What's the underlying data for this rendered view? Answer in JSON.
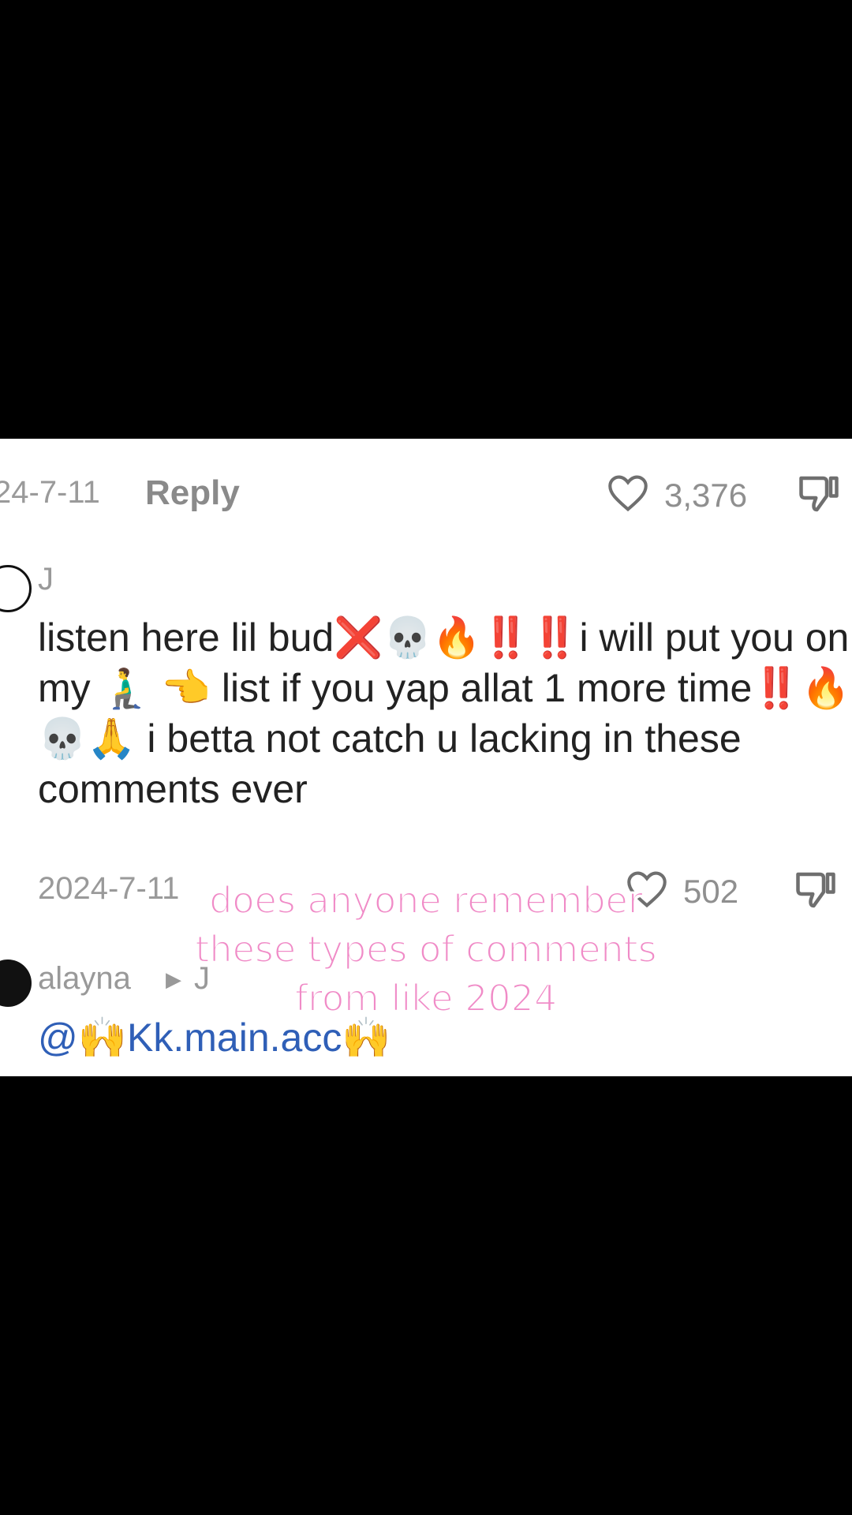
{
  "comments": [
    {
      "meta_row": {
        "date": "24-7-11",
        "reply_label": "Reply",
        "like_count": "3,376"
      }
    },
    {
      "username": "J",
      "text": "listen here lil bud❌💀🔥‼️‼️i will put you on my 🧎‍♂️ 👈 list if you yap allat 1 more time‼️🔥💀🙏 i betta not catch u lacking in these comments ever",
      "meta_row": {
        "date": "2024-7-11",
        "like_count": "502"
      }
    },
    {
      "username": "alayna",
      "reply_to": "J",
      "mention": "@🙌Kk.main.acc🙌"
    }
  ],
  "overlay_caption": {
    "line1": "does anyone remember",
    "line2": "these types of comments",
    "line3": "from like 2024"
  },
  "icons": [
    "heart-icon",
    "dislike-icon",
    "avatar",
    "caret-right-icon"
  ],
  "colors": {
    "background": "#000000",
    "panel": "#ffffff",
    "mention": "#2f5fb7",
    "caption_fill": "#f08bc7",
    "caption_stroke": "#ffffff"
  }
}
